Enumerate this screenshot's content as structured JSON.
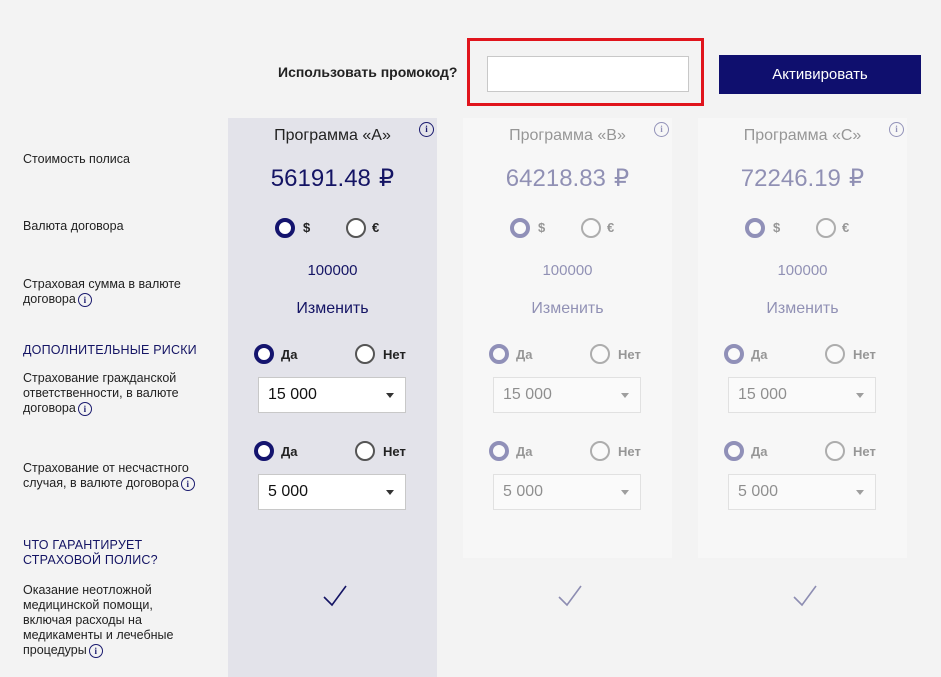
{
  "promo": {
    "label": "Использовать промокод?",
    "input_value": "",
    "button_label": "Активировать"
  },
  "rows": {
    "policy_cost": "Стоимость полиса",
    "currency": "Валюта договора",
    "sum_insured_line1": "Страховая сумма в валюте",
    "sum_insured_line2": "договора",
    "additional_risks": "ДОПОЛНИТЕЛЬНЫЕ РИСКИ",
    "liability_line1": "Страхование гражданской",
    "liability_line2": "ответственности, в валюте",
    "liability_line3": "договора",
    "accident_line1": "Страхование от несчастного",
    "accident_line2": "случая, в валюте договора",
    "guarantee_line1": "ЧТО ГАРАНТИРУЕТ",
    "guarantee_line2": "СТРАХОВОЙ ПОЛИС?",
    "medical_line1": "Оказание неотложной",
    "medical_line2": "медицинской помощи,",
    "medical_line3": "включая расходы на",
    "medical_line4": "медикаменты и лечебные",
    "medical_line5": "процедуры"
  },
  "info_glyph": "i",
  "programs": [
    {
      "title": "Программа «А»",
      "price": "56191.48",
      "currency_symbol": "₽",
      "currency_options": [
        "$",
        "€"
      ],
      "selected_currency": "$",
      "sum_insured": "100000",
      "change_label": "Изменить",
      "yes_label": "Да",
      "no_label": "Нет",
      "liability": {
        "selected": "Да",
        "amount": "15 000"
      },
      "accident": {
        "selected": "Да",
        "amount": "5 000"
      },
      "medical_included": true,
      "active": true
    },
    {
      "title": "Программа «В»",
      "price": "64218.83",
      "currency_symbol": "₽",
      "currency_options": [
        "$",
        "€"
      ],
      "selected_currency": "$",
      "sum_insured": "100000",
      "change_label": "Изменить",
      "yes_label": "Да",
      "no_label": "Нет",
      "liability": {
        "selected": "Да",
        "amount": "15 000"
      },
      "accident": {
        "selected": "Да",
        "amount": "5 000"
      },
      "medical_included": true,
      "active": false
    },
    {
      "title": "Программа «С»",
      "price": "72246.19",
      "currency_symbol": "₽",
      "currency_options": [
        "$",
        "€"
      ],
      "selected_currency": "$",
      "sum_insured": "100000",
      "change_label": "Изменить",
      "yes_label": "Да",
      "no_label": "Нет",
      "liability": {
        "selected": "Да",
        "amount": "15 000"
      },
      "accident": {
        "selected": "Да",
        "amount": "5 000"
      },
      "medical_included": true,
      "active": false
    }
  ],
  "colors": {
    "brand": "#0f0f6e",
    "highlight": "#e0141c",
    "active_column": "#e3e3ea"
  }
}
